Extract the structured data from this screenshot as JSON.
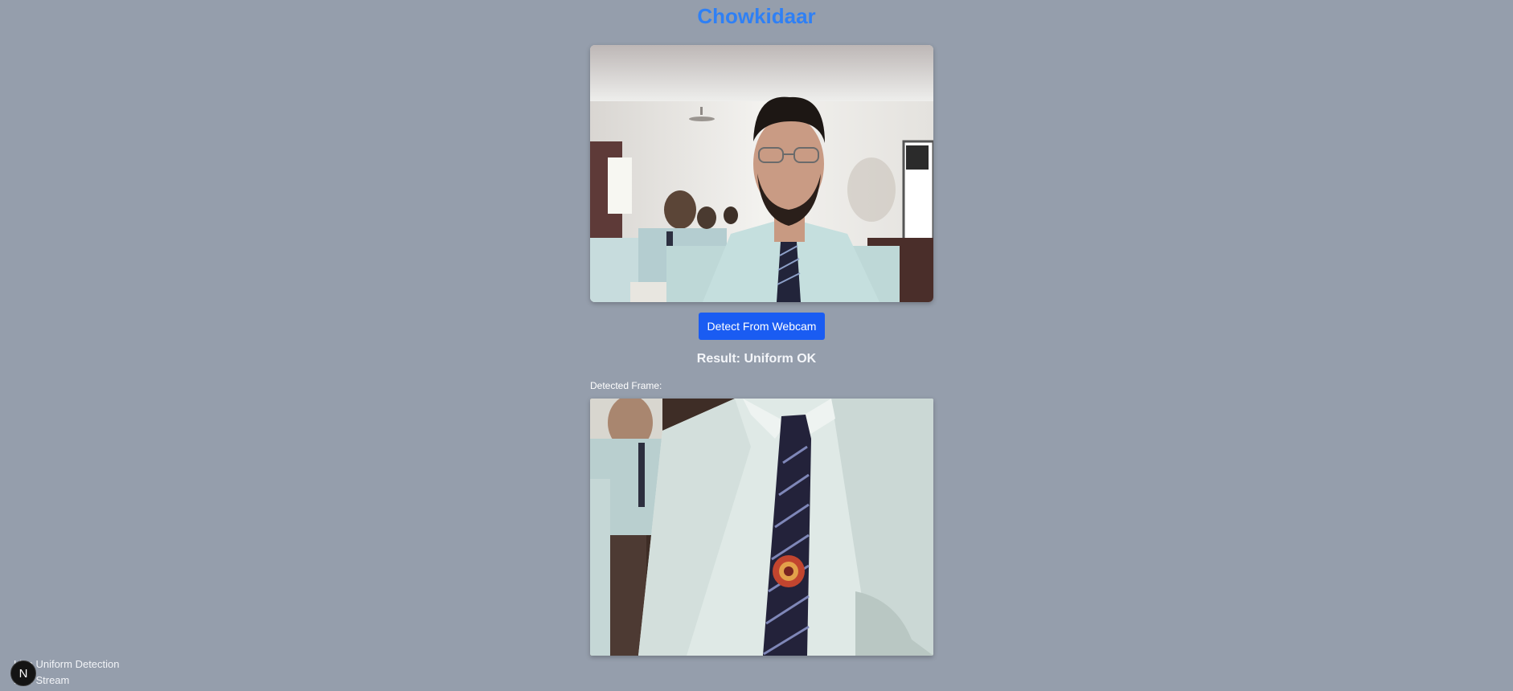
{
  "header": {
    "title": "Chowkidaar"
  },
  "webcam": {
    "description": "live-webcam-feed"
  },
  "actions": {
    "detect_label": "Detect From Webcam"
  },
  "result": {
    "text": "Result: Uniform OK"
  },
  "detected": {
    "label": "Detected Frame:"
  },
  "footer": {
    "line1": "Live Uniform Detection",
    "line2": "Live Stream",
    "badge_letter": "N"
  },
  "colors": {
    "background": "#959eac",
    "title": "#2f80f5",
    "button": "#1a5cf2"
  }
}
